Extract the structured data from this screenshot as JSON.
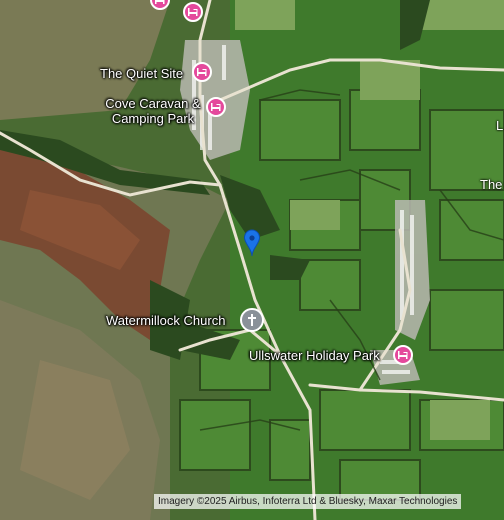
{
  "map": {
    "type": "satellite",
    "attribution": "Imagery ©2025 Airbus, Infoterra Ltd & Bluesky, Maxar Technologies"
  },
  "places": {
    "quiet_site": {
      "label": "The Quiet Site",
      "icon": "lodging-icon"
    },
    "cove": {
      "label_line1": "Cove Caravan &",
      "label_line2": "Camping Park",
      "icon": "lodging-icon"
    },
    "church": {
      "label": "Watermillock Church",
      "icon": "church-icon"
    },
    "ullswater": {
      "label": "Ullswater Holiday Park",
      "icon": "lodging-icon"
    },
    "top_partial": {
      "icon": "lodging-icon"
    }
  },
  "edge_text": {
    "right_the": "The",
    "right_l": "L"
  },
  "colors": {
    "lodging": "#e4499c",
    "church": "#8a9199",
    "pin": "#1a73e8",
    "road": "#e8e2d0"
  }
}
